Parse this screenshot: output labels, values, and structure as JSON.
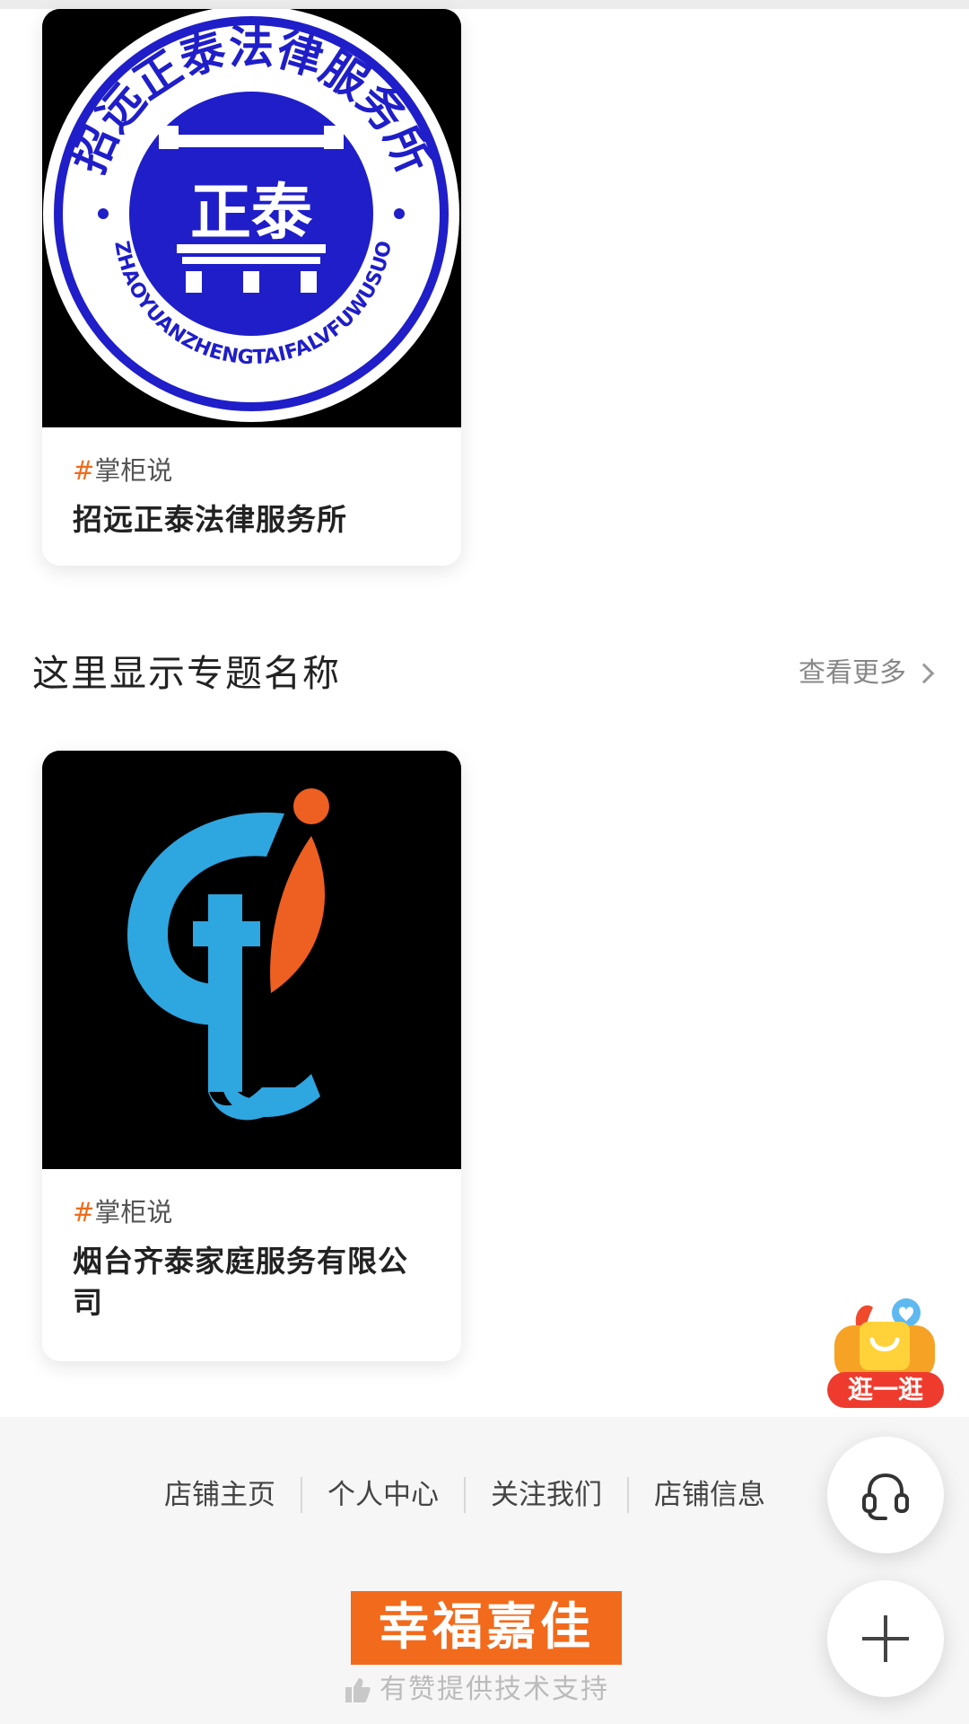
{
  "cards": [
    {
      "tag_hash": "#",
      "tag": "掌柜说",
      "name": "招远正泰法律服务所",
      "logo": {
        "ring_text": "招远正泰法律服务所",
        "ring_text_latin": "ZHAOYUANZHENGTAIFALVFUWUSUO",
        "center_text": "正泰",
        "colors": {
          "ring": "#1f1ec9",
          "background": "#000000"
        }
      }
    },
    {
      "tag_hash": "#",
      "tag": "掌柜说",
      "name": "烟台齐泰家庭服务有限公司",
      "logo": {
        "colors": {
          "blue": "#2ea6e0",
          "orange": "#ee5f22",
          "background": "#000000"
        }
      }
    }
  ],
  "section": {
    "title": "这里显示专题名称",
    "see_more": "查看更多"
  },
  "footer": {
    "links": [
      "店铺主页",
      "个人中心",
      "关注我们",
      "店铺信息"
    ],
    "brand": "幸福嘉佳",
    "support": "有赞提供技术支持"
  },
  "floating": {
    "stroll_label": "逛一逛",
    "service_icon": "headset-icon",
    "plus_icon": "plus-icon"
  },
  "colors": {
    "accent": "#f06b1c",
    "brand": "#f26a1b"
  }
}
